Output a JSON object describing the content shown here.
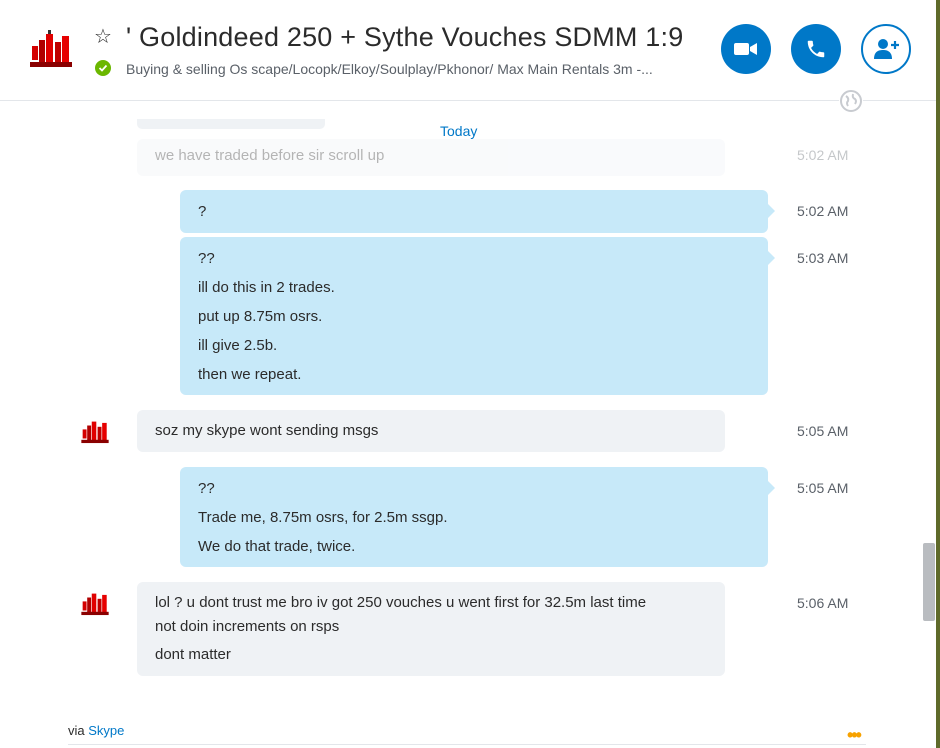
{
  "header": {
    "title": "' Goldindeed 250 + Sythe Vouches SDMM 1:9",
    "mood": "Buying & selling Os scape/Locopk/Elkoy/Soulplay/Pkhonor/ Max Main Rentals 3m -...",
    "status": "online",
    "icons": [
      "star-icon",
      "video-call-icon",
      "audio-call-icon",
      "add-people-icon",
      "globe-icon"
    ],
    "accent_color": "#0078c8",
    "status_color": "#6bb700"
  },
  "chat": {
    "day_label": "Today",
    "messages": [
      {
        "direction": "in",
        "lines": [
          "we have traded before sir scroll up"
        ],
        "time": "5:02 AM",
        "faded": true
      },
      {
        "direction": "out",
        "lines": [
          "?"
        ],
        "time": "5:02 AM"
      },
      {
        "direction": "out",
        "lines": [
          "??",
          "ill do this in 2 trades.",
          "put up 8.75m osrs.",
          "ill give 2.5b.",
          "then we repeat."
        ],
        "time": "5:03 AM"
      },
      {
        "direction": "in",
        "lines": [
          "soz my skype wont sending msgs"
        ],
        "time": "5:05 AM"
      },
      {
        "direction": "out",
        "lines": [
          "??",
          "Trade me, 8.75m osrs, for 2.5m ssgp.",
          "We do that trade, twice."
        ],
        "time": "5:05 AM"
      },
      {
        "direction": "in",
        "lines": [
          "lol ? u dont trust me bro iv got 250 vouches u went first for 32.5m last time",
          "not doin increments on rsps",
          "dont matter"
        ],
        "time": "5:06 AM"
      }
    ]
  },
  "footer": {
    "via_label": "via",
    "via_link": "Skype",
    "more_label": "•••"
  }
}
